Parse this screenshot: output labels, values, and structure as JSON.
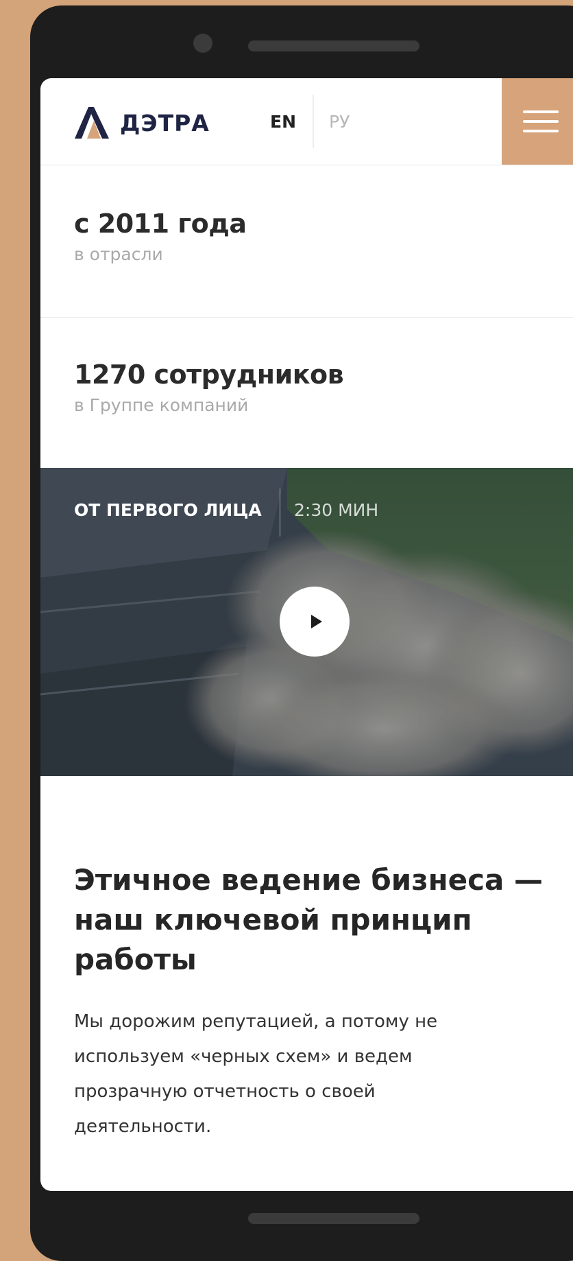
{
  "header": {
    "logo_text": "ДЭТРА",
    "lang_en": "EN",
    "lang_ru": "РУ"
  },
  "stats": [
    {
      "value": "с 2011 года",
      "label": "в отрасли"
    },
    {
      "value": "1270 сотрудников",
      "label": "в Группе компаний"
    }
  ],
  "video": {
    "tag": "ОТ ПЕРВОГО ЛИЦА",
    "duration": "2:30 МИН"
  },
  "article": {
    "title": "Этичное ведение бизнеса — наш ключевой принцип работы",
    "text": "Мы дорожим репутацией, а потому не используем «черных схем» и ведем прозрачную отчетность о своей деятельности."
  },
  "colors": {
    "accent": "#d6a37a",
    "brand_dark": "#1f2344",
    "background_frame": "#d3a47a"
  },
  "icons": {
    "logo": "detra-logo-icon",
    "menu": "hamburger-menu-icon",
    "play": "play-icon"
  }
}
